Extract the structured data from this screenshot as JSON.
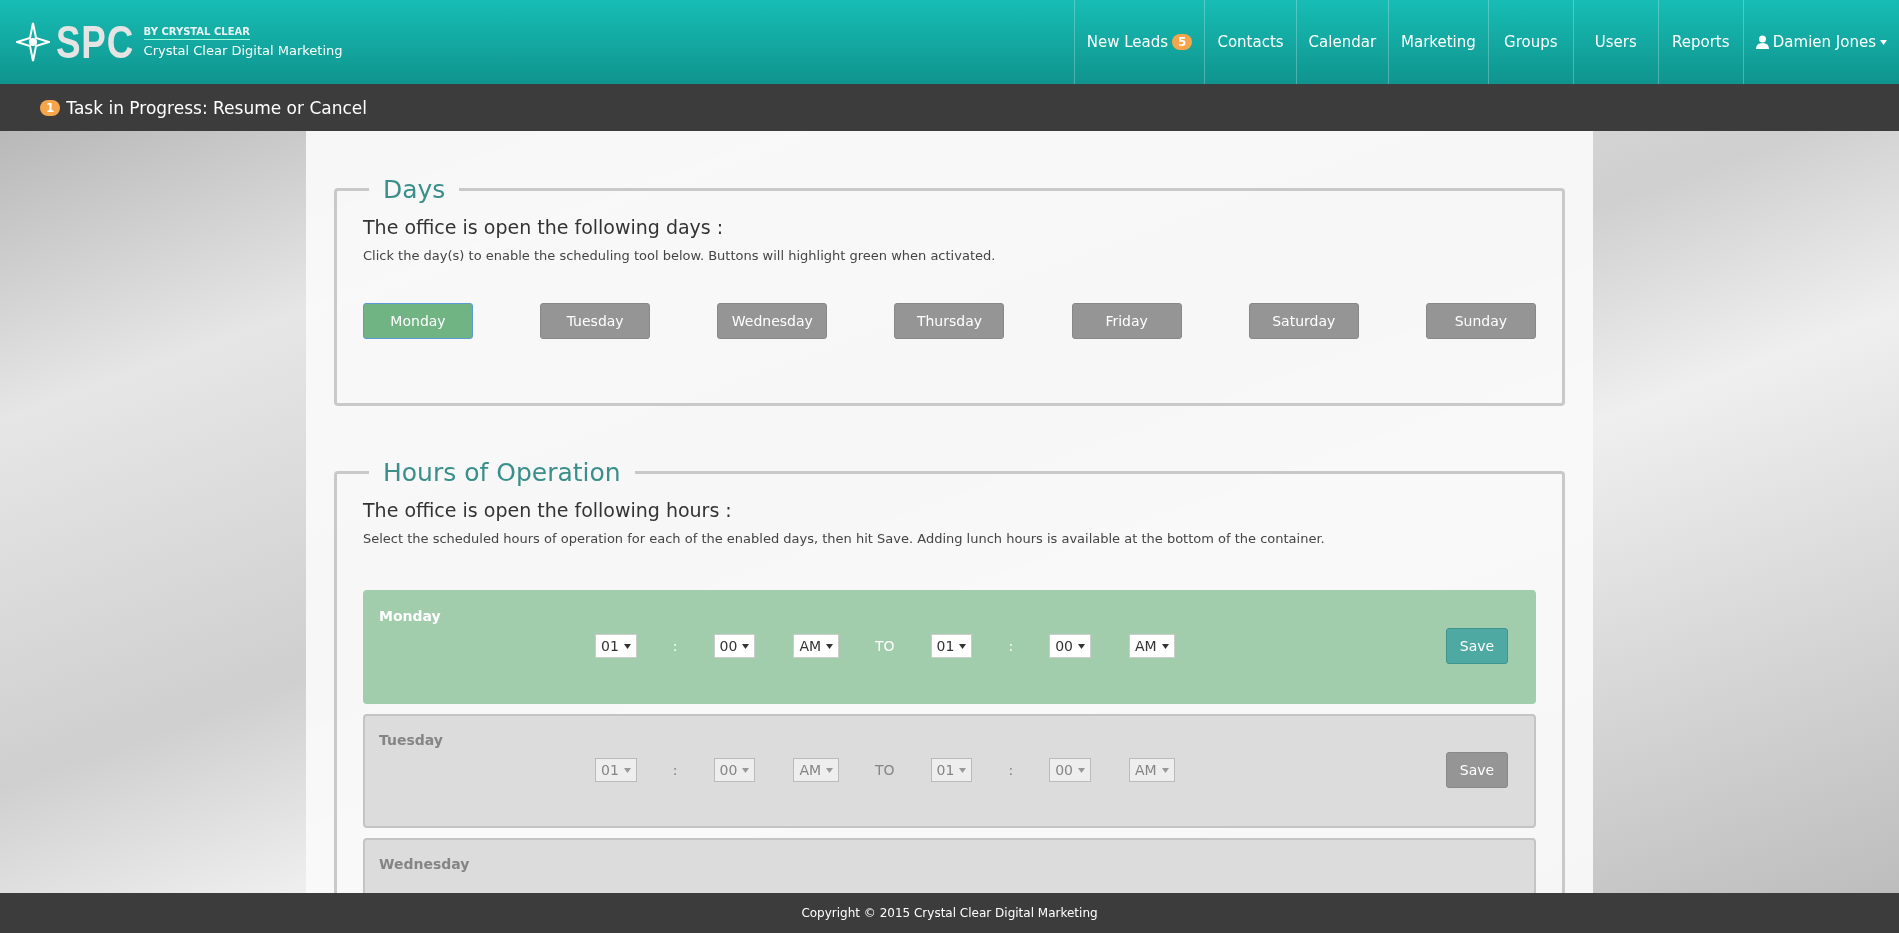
{
  "brand": {
    "logo_text": "SPC",
    "tagline": "BY CRYSTAL CLEAR",
    "company": "Crystal Clear Digital Marketing"
  },
  "nav": [
    {
      "label": "New Leads",
      "badge": "5"
    },
    {
      "label": "Contacts"
    },
    {
      "label": "Calendar"
    },
    {
      "label": "Marketing"
    },
    {
      "label": "Groups"
    },
    {
      "label": "Users"
    },
    {
      "label": "Reports"
    }
  ],
  "user_menu": {
    "label": "Damien Jones"
  },
  "task_bar": {
    "count": "1",
    "text": "Task in Progress: Resume or Cancel"
  },
  "days_section": {
    "legend": "Days",
    "heading": "The office is open the following days :",
    "hint": "Click the day(s) to enable the scheduling tool below. Buttons will highlight green when activated.",
    "days": [
      {
        "label": "Monday",
        "selected": true
      },
      {
        "label": "Tuesday",
        "selected": false
      },
      {
        "label": "Wednesday",
        "selected": false
      },
      {
        "label": "Thursday",
        "selected": false
      },
      {
        "label": "Friday",
        "selected": false
      },
      {
        "label": "Saturday",
        "selected": false
      },
      {
        "label": "Sunday",
        "selected": false
      }
    ]
  },
  "hours_section": {
    "legend": "Hours of Operation",
    "heading": "The office is open the following hours :",
    "hint": "Select the scheduled hours of operation for each of the enabled days, then hit Save. Adding lunch hours is available at the bottom of the container.",
    "rows": [
      {
        "day": "Monday",
        "enabled": true,
        "start_hour": "01",
        "start_minute": "00",
        "start_period": "AM",
        "separator": ":",
        "to": "TO",
        "end_hour": "01",
        "end_minute": "00",
        "end_period": "AM",
        "save": "Save"
      },
      {
        "day": "Tuesday",
        "enabled": false,
        "start_hour": "01",
        "start_minute": "00",
        "start_period": "AM",
        "separator": ":",
        "to": "TO",
        "end_hour": "01",
        "end_minute": "00",
        "end_period": "AM",
        "save": "Save"
      },
      {
        "day": "Wednesday",
        "enabled": false
      }
    ]
  },
  "footer": {
    "text": "Copyright © 2015 Crystal Clear Digital Marketing"
  }
}
